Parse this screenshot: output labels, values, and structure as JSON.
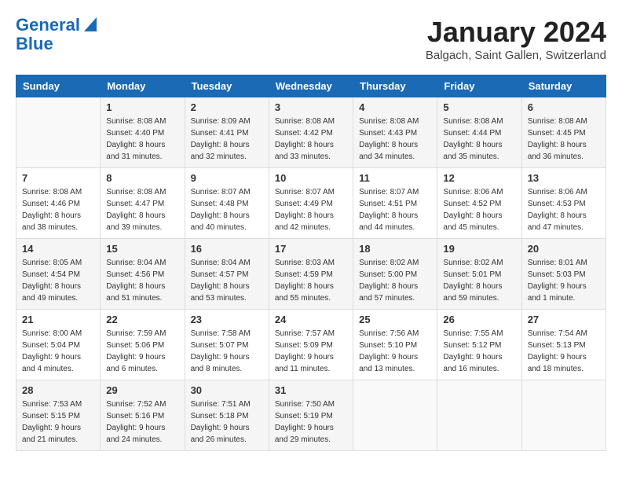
{
  "header": {
    "logo_line1": "General",
    "logo_line2": "Blue",
    "month": "January 2024",
    "location": "Balgach, Saint Gallen, Switzerland"
  },
  "days_of_week": [
    "Sunday",
    "Monday",
    "Tuesday",
    "Wednesday",
    "Thursday",
    "Friday",
    "Saturday"
  ],
  "weeks": [
    [
      {
        "day": "",
        "info": ""
      },
      {
        "day": "1",
        "info": "Sunrise: 8:08 AM\nSunset: 4:40 PM\nDaylight: 8 hours\nand 31 minutes."
      },
      {
        "day": "2",
        "info": "Sunrise: 8:09 AM\nSunset: 4:41 PM\nDaylight: 8 hours\nand 32 minutes."
      },
      {
        "day": "3",
        "info": "Sunrise: 8:08 AM\nSunset: 4:42 PM\nDaylight: 8 hours\nand 33 minutes."
      },
      {
        "day": "4",
        "info": "Sunrise: 8:08 AM\nSunset: 4:43 PM\nDaylight: 8 hours\nand 34 minutes."
      },
      {
        "day": "5",
        "info": "Sunrise: 8:08 AM\nSunset: 4:44 PM\nDaylight: 8 hours\nand 35 minutes."
      },
      {
        "day": "6",
        "info": "Sunrise: 8:08 AM\nSunset: 4:45 PM\nDaylight: 8 hours\nand 36 minutes."
      }
    ],
    [
      {
        "day": "7",
        "info": "Sunrise: 8:08 AM\nSunset: 4:46 PM\nDaylight: 8 hours\nand 38 minutes."
      },
      {
        "day": "8",
        "info": "Sunrise: 8:08 AM\nSunset: 4:47 PM\nDaylight: 8 hours\nand 39 minutes."
      },
      {
        "day": "9",
        "info": "Sunrise: 8:07 AM\nSunset: 4:48 PM\nDaylight: 8 hours\nand 40 minutes."
      },
      {
        "day": "10",
        "info": "Sunrise: 8:07 AM\nSunset: 4:49 PM\nDaylight: 8 hours\nand 42 minutes."
      },
      {
        "day": "11",
        "info": "Sunrise: 8:07 AM\nSunset: 4:51 PM\nDaylight: 8 hours\nand 44 minutes."
      },
      {
        "day": "12",
        "info": "Sunrise: 8:06 AM\nSunset: 4:52 PM\nDaylight: 8 hours\nand 45 minutes."
      },
      {
        "day": "13",
        "info": "Sunrise: 8:06 AM\nSunset: 4:53 PM\nDaylight: 8 hours\nand 47 minutes."
      }
    ],
    [
      {
        "day": "14",
        "info": "Sunrise: 8:05 AM\nSunset: 4:54 PM\nDaylight: 8 hours\nand 49 minutes."
      },
      {
        "day": "15",
        "info": "Sunrise: 8:04 AM\nSunset: 4:56 PM\nDaylight: 8 hours\nand 51 minutes."
      },
      {
        "day": "16",
        "info": "Sunrise: 8:04 AM\nSunset: 4:57 PM\nDaylight: 8 hours\nand 53 minutes."
      },
      {
        "day": "17",
        "info": "Sunrise: 8:03 AM\nSunset: 4:59 PM\nDaylight: 8 hours\nand 55 minutes."
      },
      {
        "day": "18",
        "info": "Sunrise: 8:02 AM\nSunset: 5:00 PM\nDaylight: 8 hours\nand 57 minutes."
      },
      {
        "day": "19",
        "info": "Sunrise: 8:02 AM\nSunset: 5:01 PM\nDaylight: 8 hours\nand 59 minutes."
      },
      {
        "day": "20",
        "info": "Sunrise: 8:01 AM\nSunset: 5:03 PM\nDaylight: 9 hours\nand 1 minute."
      }
    ],
    [
      {
        "day": "21",
        "info": "Sunrise: 8:00 AM\nSunset: 5:04 PM\nDaylight: 9 hours\nand 4 minutes."
      },
      {
        "day": "22",
        "info": "Sunrise: 7:59 AM\nSunset: 5:06 PM\nDaylight: 9 hours\nand 6 minutes."
      },
      {
        "day": "23",
        "info": "Sunrise: 7:58 AM\nSunset: 5:07 PM\nDaylight: 9 hours\nand 8 minutes."
      },
      {
        "day": "24",
        "info": "Sunrise: 7:57 AM\nSunset: 5:09 PM\nDaylight: 9 hours\nand 11 minutes."
      },
      {
        "day": "25",
        "info": "Sunrise: 7:56 AM\nSunset: 5:10 PM\nDaylight: 9 hours\nand 13 minutes."
      },
      {
        "day": "26",
        "info": "Sunrise: 7:55 AM\nSunset: 5:12 PM\nDaylight: 9 hours\nand 16 minutes."
      },
      {
        "day": "27",
        "info": "Sunrise: 7:54 AM\nSunset: 5:13 PM\nDaylight: 9 hours\nand 18 minutes."
      }
    ],
    [
      {
        "day": "28",
        "info": "Sunrise: 7:53 AM\nSunset: 5:15 PM\nDaylight: 9 hours\nand 21 minutes."
      },
      {
        "day": "29",
        "info": "Sunrise: 7:52 AM\nSunset: 5:16 PM\nDaylight: 9 hours\nand 24 minutes."
      },
      {
        "day": "30",
        "info": "Sunrise: 7:51 AM\nSunset: 5:18 PM\nDaylight: 9 hours\nand 26 minutes."
      },
      {
        "day": "31",
        "info": "Sunrise: 7:50 AM\nSunset: 5:19 PM\nDaylight: 9 hours\nand 29 minutes."
      },
      {
        "day": "",
        "info": ""
      },
      {
        "day": "",
        "info": ""
      },
      {
        "day": "",
        "info": ""
      }
    ]
  ]
}
